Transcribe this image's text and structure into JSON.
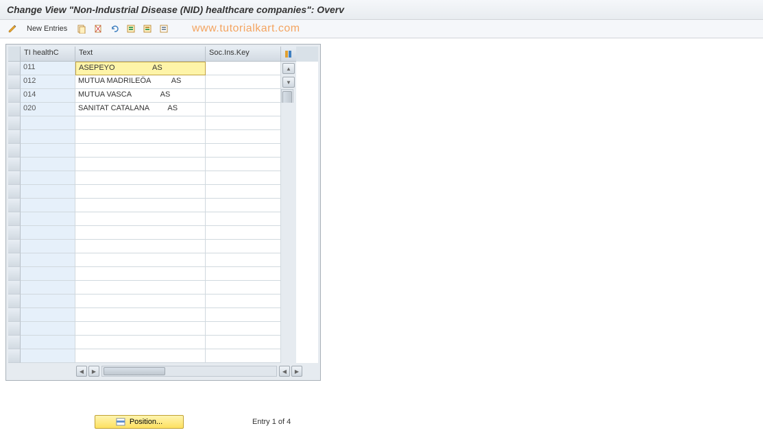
{
  "title": "Change View \"Non-Industrial Disease (NID) healthcare companies\": Overv",
  "toolbar": {
    "new_entries": "New Entries"
  },
  "watermark": "www.tutorialkart.com",
  "columns": {
    "col1": "TI healthC",
    "col2": "Text",
    "col3": "Soc.Ins.Key"
  },
  "rows": [
    {
      "id": "011",
      "text": "ASEPEYO                  AS",
      "key": "",
      "selected": true
    },
    {
      "id": "012",
      "text": "MUTUA MADRILEÖA          AS",
      "key": "",
      "selected": false
    },
    {
      "id": "014",
      "text": "MUTUA VASCA              AS",
      "key": "",
      "selected": false
    },
    {
      "id": "020",
      "text": "SANITAT CATALANA         AS",
      "key": "",
      "selected": false
    }
  ],
  "empty_row_count": 18,
  "footer": {
    "position_button": "Position...",
    "entry_text": "Entry 1 of 4"
  },
  "col_widths": {
    "c1": 80,
    "c2": 190,
    "c3": 110
  }
}
